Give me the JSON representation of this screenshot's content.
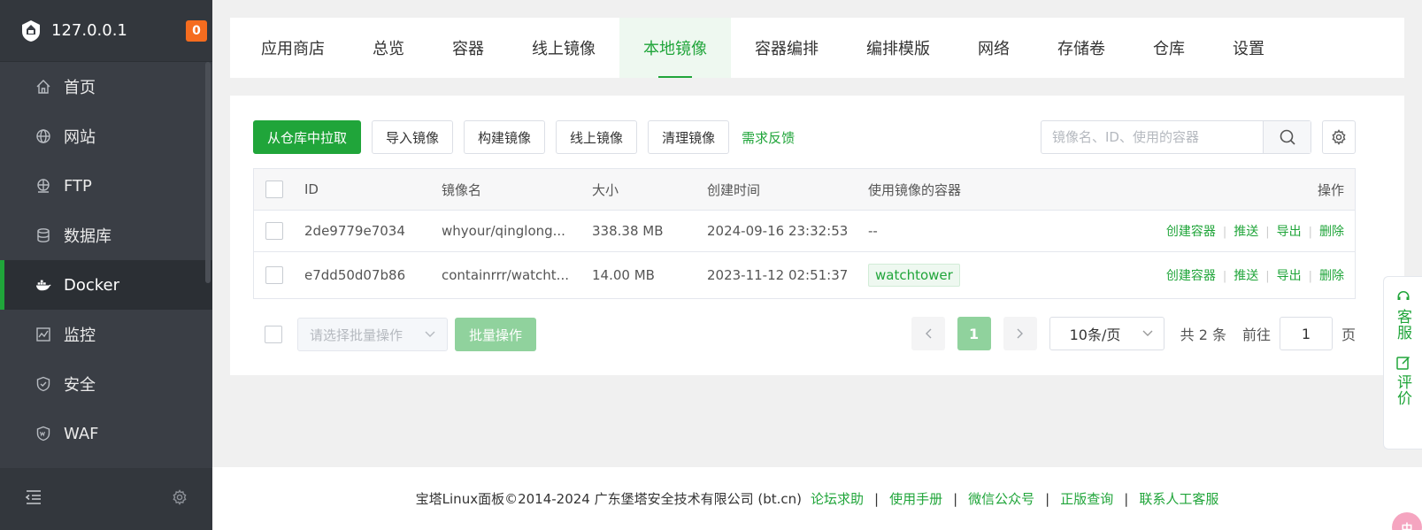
{
  "sidebar": {
    "host": "127.0.0.1",
    "badge": "0",
    "items": [
      {
        "label": "首页",
        "icon": "home-icon"
      },
      {
        "label": "网站",
        "icon": "globe-icon"
      },
      {
        "label": "FTP",
        "icon": "ftp-icon"
      },
      {
        "label": "数据库",
        "icon": "database-icon"
      },
      {
        "label": "Docker",
        "icon": "docker-icon",
        "active": true
      },
      {
        "label": "监控",
        "icon": "monitor-icon"
      },
      {
        "label": "安全",
        "icon": "shield-icon"
      },
      {
        "label": "WAF",
        "icon": "waf-icon"
      }
    ]
  },
  "tabs": [
    {
      "label": "应用商店"
    },
    {
      "label": "总览"
    },
    {
      "label": "容器"
    },
    {
      "label": "线上镜像"
    },
    {
      "label": "本地镜像",
      "active": true
    },
    {
      "label": "容器编排"
    },
    {
      "label": "编排模版"
    },
    {
      "label": "网络"
    },
    {
      "label": "存储卷"
    },
    {
      "label": "仓库"
    },
    {
      "label": "设置"
    }
  ],
  "toolbar": {
    "pull_label": "从仓库中拉取",
    "import_label": "导入镜像",
    "build_label": "构建镜像",
    "online_label": "线上镜像",
    "clean_label": "清理镜像",
    "feedback_label": "需求反馈",
    "search_placeholder": "镜像名、ID、使用的容器"
  },
  "table": {
    "headers": {
      "id": "ID",
      "name": "镜像名",
      "size": "大小",
      "time": "创建时间",
      "containers": "使用镜像的容器",
      "ops": "操作"
    },
    "rows": [
      {
        "id": "2de9779e7034",
        "name": "whyour/qinglong...",
        "size": "338.38 MB",
        "time": "2024-09-16 23:32:53",
        "containers": "--"
      },
      {
        "id": "e7dd50d07b86",
        "name": "containrrr/watcht...",
        "size": "14.00 MB",
        "time": "2023-11-12 02:51:37",
        "containers": "watchtower"
      }
    ],
    "ops": {
      "create": "创建容器",
      "push": "推送",
      "export": "导出",
      "delete": "删除"
    }
  },
  "bulk": {
    "select_placeholder": "请选择批量操作",
    "button_label": "批量操作"
  },
  "pager": {
    "current": "1",
    "page_size": "10条/页",
    "total": "共 2 条",
    "goto_label": "前往",
    "goto_value": "1",
    "page_suffix": "页"
  },
  "footer": {
    "copyright": "宝塔Linux面板©2014-2024 广东堡塔安全技术有限公司 (bt.cn)",
    "links": [
      "论坛求助",
      "使用手册",
      "微信公众号",
      "正版查询",
      "联系人工客服"
    ]
  },
  "float": {
    "service": "客服",
    "review": "评价",
    "avatar_text": "中"
  },
  "colors": {
    "accent": "#20a53a",
    "sidebar": "#3a3e45",
    "badge": "#f56c1f"
  }
}
